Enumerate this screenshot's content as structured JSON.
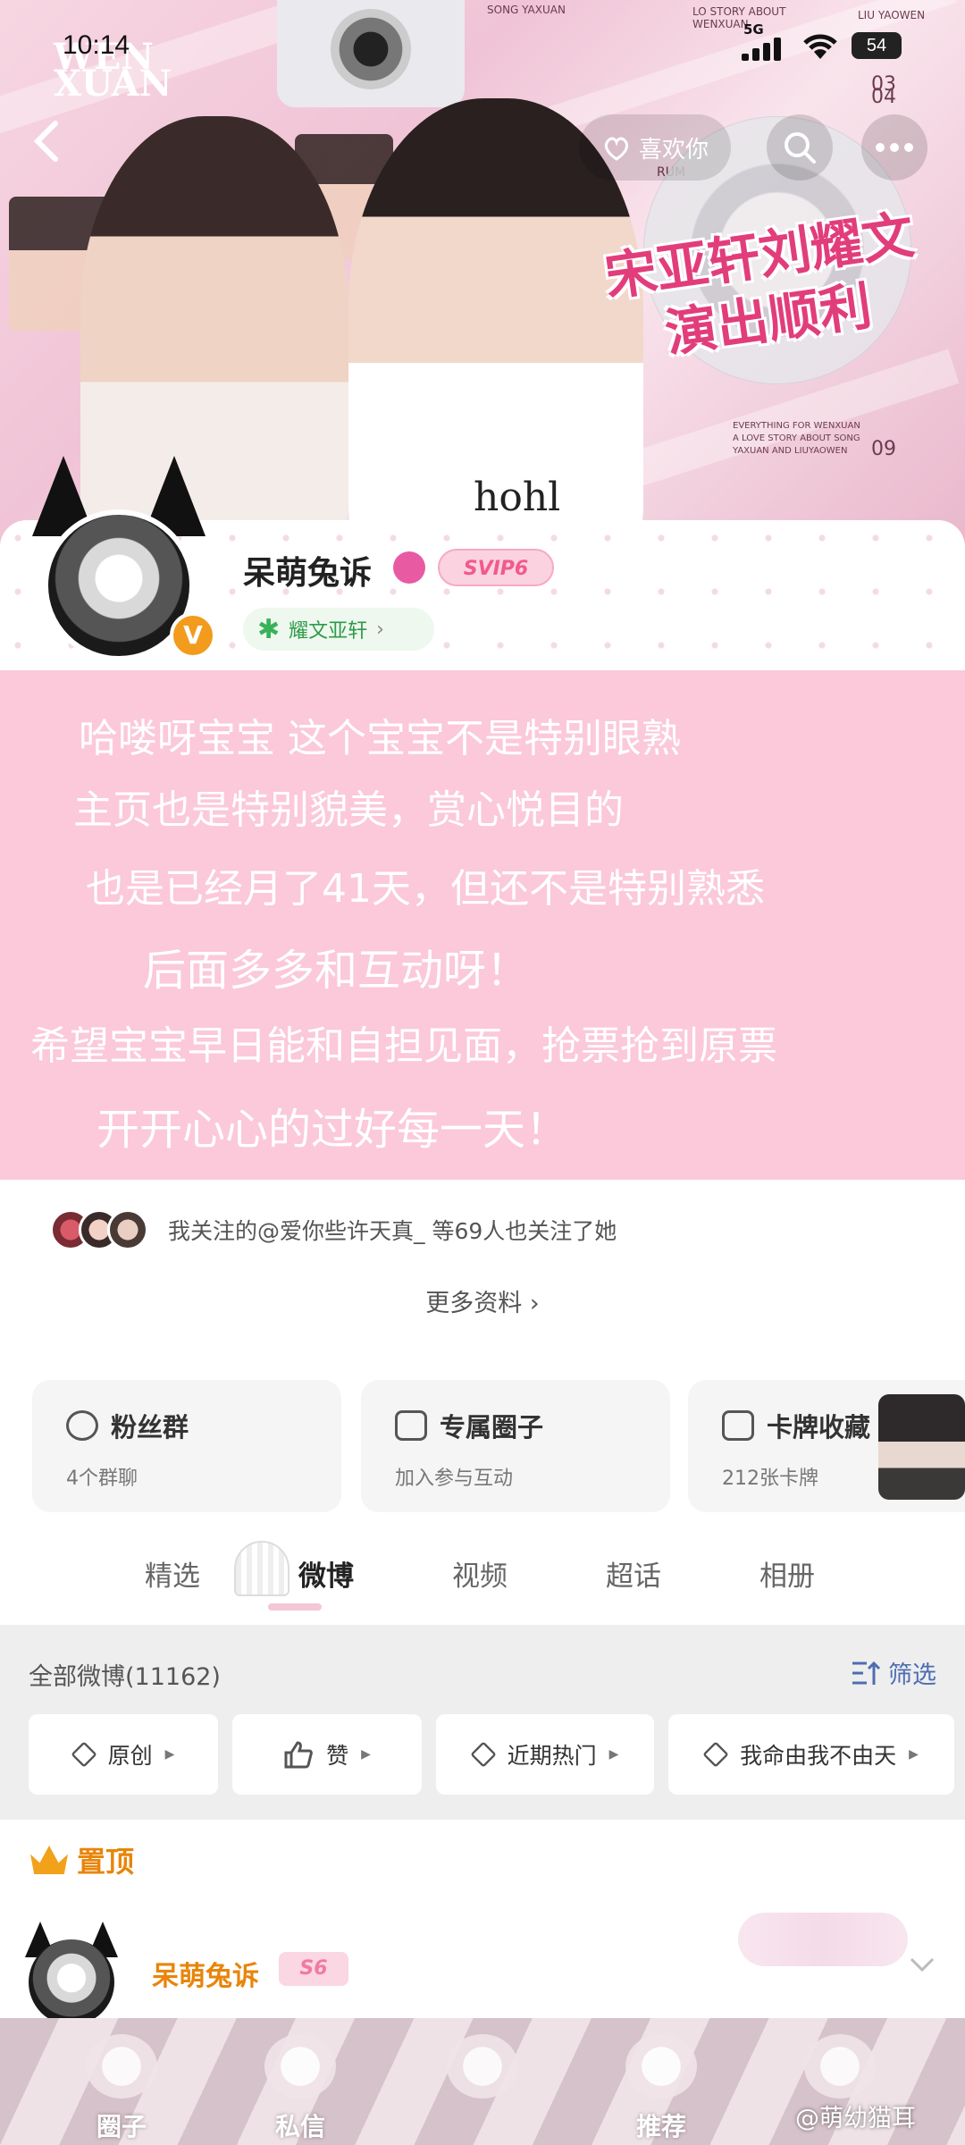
{
  "status_bar": {
    "time": "10:14",
    "network": "5G",
    "battery": "54"
  },
  "banner": {
    "logo_top": "WEN",
    "logo_bottom": "XUAN",
    "slogan_line1": "宋亚轩刘耀文",
    "slogan_line2": "演出顺利",
    "names_line": "SONG YAXUAN",
    "story_line": "LO STORY ABOUT WENXUAN",
    "liu_line": "LIU YAOWEN",
    "date_top": "03 04",
    "date_bottom": "09",
    "banner_text": "hohl",
    "caption": "EVERYTHING FOR WENXUAN A LOVE STORY ABOUT SONG YAXUAN AND LIUYAOWEN",
    "tag": "RUM"
  },
  "header": {
    "like_label": "喜欢你"
  },
  "profile": {
    "username": "呆萌兔诉",
    "vip_badge": "SVIP6",
    "verified_label": "V",
    "fan_tag": "耀文亚轩"
  },
  "overlay": {
    "lines": [
      "哈喽呀宝宝 这个宝宝不是特别眼熟",
      "主页也是特别貌美，赏心悦目的",
      "也是已经月了41天，但还不是特别熟悉",
      "后面多多和互动呀！",
      "希望宝宝早日能和自担见面，抢票抢到原票",
      "开开心心的过好每一天！"
    ]
  },
  "follow": {
    "text": "我关注的@爱你些许天真_ 等69人也关注了她"
  },
  "more_info": "更多资料",
  "cards": [
    {
      "title": "粉丝群",
      "sub": "4个群聊"
    },
    {
      "title": "专属圈子",
      "sub": "加入参与互动"
    },
    {
      "title": "卡牌收藏",
      "sub": "212张卡牌"
    }
  ],
  "tabs": [
    "精选",
    "微博",
    "视频",
    "超话",
    "相册"
  ],
  "feed": {
    "count": "全部微博(11162)",
    "filter": "筛选",
    "filters": [
      "原创",
      "赞",
      "近期热门",
      "我命由我不由天"
    ]
  },
  "pinned_label": "置顶",
  "post": {
    "name": "呆萌兔诉",
    "badge": "S6"
  },
  "tabbar": {
    "items": [
      "圈子",
      "私信",
      "推荐"
    ]
  },
  "watermark": "@萌幼猫耳",
  "colors": {
    "overlay_pink": "#fbc9d9",
    "accent_orange": "#e8850a",
    "filter_blue": "#4c6eb0",
    "fan_green": "#2f9a4a"
  }
}
